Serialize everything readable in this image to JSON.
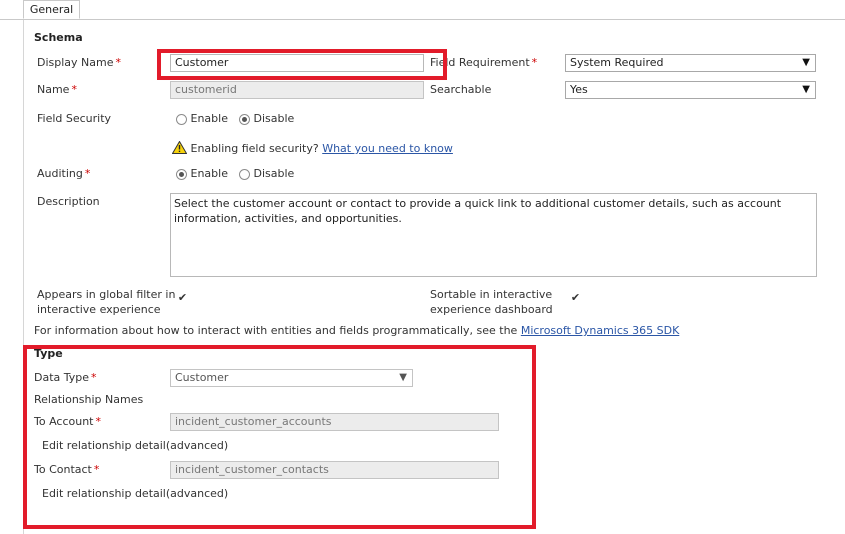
{
  "tabs": [
    {
      "label": "General"
    }
  ],
  "schema": {
    "heading": "Schema",
    "display_name_label": "Display Name",
    "display_name_value": "Customer",
    "field_requirement_label": "Field Requirement",
    "field_requirement_value": "System Required",
    "name_label": "Name",
    "name_value": "customerid",
    "searchable_label": "Searchable",
    "searchable_value": "Yes",
    "field_security_label": "Field Security",
    "enable_label": "Enable",
    "disable_label": "Disable",
    "field_security_selected": "Disable",
    "warning_text": "Enabling field security?",
    "warning_link": "What you need to know",
    "auditing_label": "Auditing",
    "auditing_selected": "Enable",
    "description_label": "Description",
    "description_value": "Select the customer account or contact to provide a quick link to additional customer details, such as account information, activities, and opportunities.",
    "global_filter_label_1": "Appears in global filter in",
    "global_filter_label_2": "interactive experience",
    "global_filter_checked": true,
    "sortable_label_1": "Sortable in interactive",
    "sortable_label_2": "experience dashboard",
    "sortable_checked": true,
    "info_text": "For information about how to interact with entities and fields programmatically, see the",
    "info_link": "Microsoft Dynamics 365 SDK"
  },
  "type_section": {
    "heading": "Type",
    "data_type_label": "Data Type",
    "data_type_value": "Customer",
    "relationship_names_label": "Relationship Names",
    "to_account_label": "To Account",
    "to_account_value": "incident_customer_accounts",
    "to_account_edit": "Edit relationship detail(advanced)",
    "to_contact_label": "To Contact",
    "to_contact_value": "incident_customer_contacts",
    "to_contact_edit": "Edit relationship detail(advanced)"
  },
  "required_marker": "*",
  "icons": {
    "warning": "warning-triangle-icon",
    "dropdown": "chevron-down-icon",
    "check": "checkmark-icon"
  },
  "colors": {
    "highlight": "#e21b2a",
    "link": "#2b56a6",
    "required": "#cc0000"
  }
}
